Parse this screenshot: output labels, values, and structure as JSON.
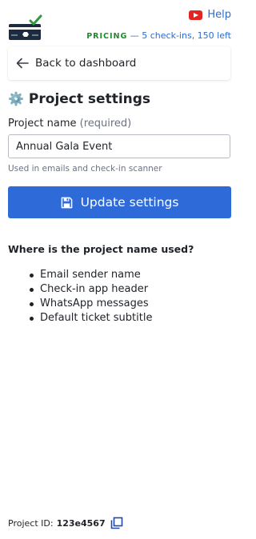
{
  "header": {
    "help_label": "Help",
    "pricing_label": "PRICING",
    "pricing_detail": "— 5 check-ins, 150 left",
    "icons": {
      "logo": "ticket-check-logo",
      "help": "youtube-play-icon"
    }
  },
  "nav": {
    "back_label": "Back to dashboard",
    "back_icon": "arrow-left-icon"
  },
  "settings": {
    "title": "Project settings",
    "title_icon": "⚙️",
    "name_label": "Project name",
    "name_required": "(required)",
    "name_value": "Annual Gala Event",
    "name_hint": "Used in emails and check-in scanner",
    "update_label": "Update settings",
    "update_icon": "save-icon"
  },
  "usage": {
    "title": "Where is the project name used?",
    "items": [
      "Email sender name",
      "Check-in app header",
      "WhatsApp messages",
      "Default ticket subtitle"
    ]
  },
  "footer": {
    "project_id_label": "Project ID:",
    "project_id_value": "123e4567",
    "copy_icon": "copy-icon"
  },
  "colors": {
    "accent": "#2f6ad9",
    "link": "#2b6cd1",
    "pricing_green": "#1e8a2e",
    "youtube_red": "#e52421"
  }
}
